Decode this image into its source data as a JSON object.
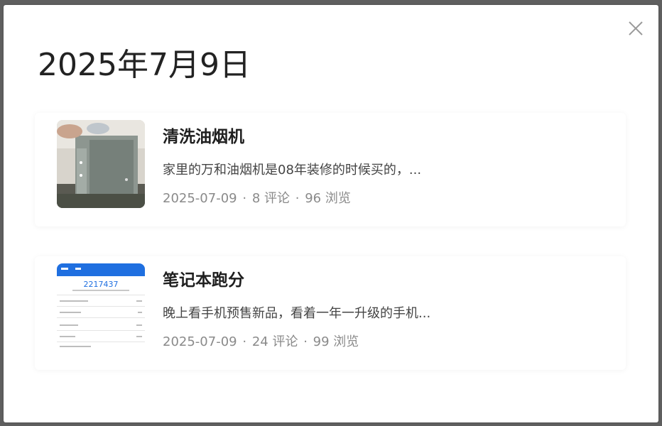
{
  "dialog": {
    "date_title": "2025年7月9日"
  },
  "posts": [
    {
      "title": "清洗油烟机",
      "excerpt": "家里的万和油烟机是08年装修的时候买的，...",
      "date": "2025-07-09",
      "comments": "8 评论",
      "views": "96 浏览",
      "thumbnail_icon": "range-hood-photo"
    },
    {
      "title": "笔记本跑分",
      "excerpt": "晚上看手机预售新品，看着一年一升级的手机...",
      "date": "2025-07-09",
      "comments": "24 评论",
      "views": "99 浏览",
      "thumbnail_icon": "benchmark-screenshot",
      "thumbnail_score": "2217437"
    }
  ],
  "meta_separator": "·",
  "colors": {
    "backdrop": "#5f5f5f",
    "modal": "#ffffff",
    "title": "#222222",
    "meta": "#8a8a8a",
    "accent_blue": "#1f6fe0"
  }
}
